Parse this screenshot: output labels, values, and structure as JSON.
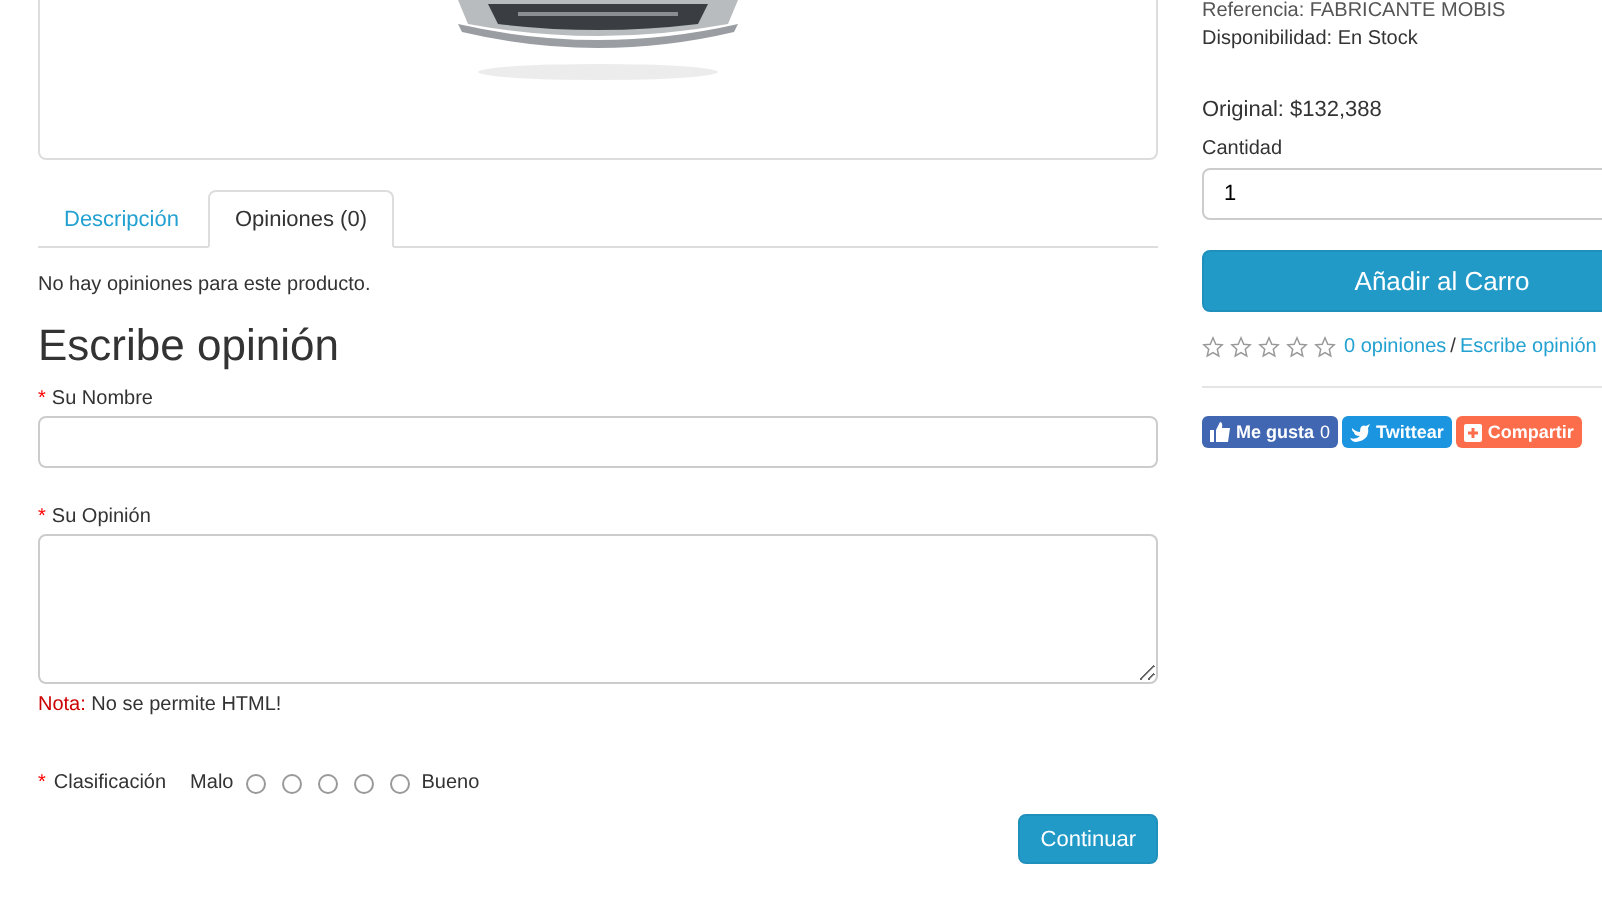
{
  "tabs": [
    {
      "label": "Descripción",
      "selected": false
    },
    {
      "label": "Opiniones (0)",
      "selected": true
    }
  ],
  "no_reviews_text": "No hay opiniones para este producto.",
  "review_form": {
    "heading": "Escribe opinión",
    "required_mark": "*",
    "name_label": "Su Nombre",
    "review_label": "Su Opinión",
    "note_label": "Nota:",
    "note_text": "No se permite HTML!",
    "rating_label": "Clasificación",
    "rating_low": "Malo",
    "rating_high": "Bueno",
    "rating_options": [
      {
        "selected": false
      },
      {
        "selected": false
      },
      {
        "selected": false
      },
      {
        "selected": false
      },
      {
        "selected": false
      }
    ],
    "submit": "Continuar"
  },
  "product_info": {
    "reference": "Referencia: FABRICANTE MOBIS",
    "availability": "Disponibilidad: En Stock",
    "price": "Original: $132,388",
    "quantity_label": "Cantidad",
    "quantity_value": "1",
    "add_to_cart": "Añadir al Carro",
    "stars": 0,
    "reviews_link": "0 opiniones",
    "separator": "/",
    "write_review_link": "Escribe opinión"
  },
  "social": [
    {
      "kind": "like",
      "label": "Me gusta",
      "count": "0",
      "color": "#4267b2"
    },
    {
      "kind": "tweet",
      "label": "Twittear",
      "color": "#1b95e0"
    },
    {
      "kind": "share",
      "label": "Compartir",
      "color": "#fc6d4c"
    }
  ]
}
